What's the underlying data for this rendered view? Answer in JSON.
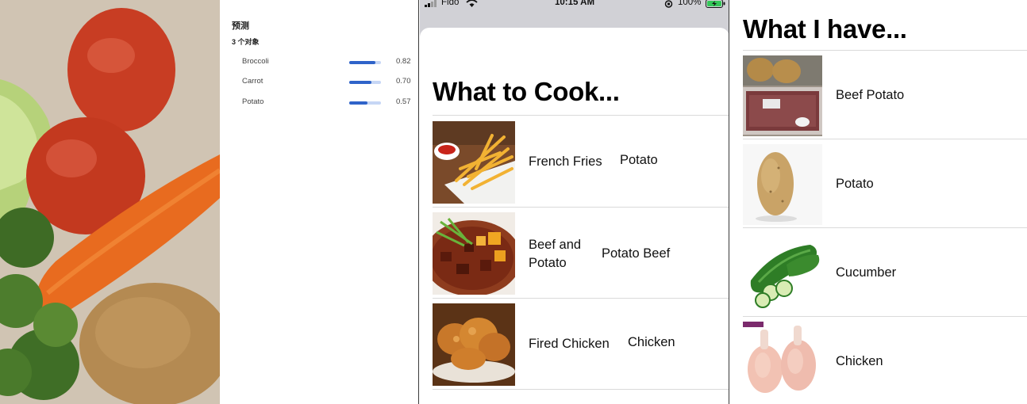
{
  "predictions": {
    "title": "预测",
    "count": "3 个对象",
    "items": [
      {
        "label": "Broccoli",
        "score": 0.82,
        "score_text": "0.82"
      },
      {
        "label": "Carrot",
        "score": 0.7,
        "score_text": "0.70"
      },
      {
        "label": "Potato",
        "score": 0.57,
        "score_text": "0.57"
      }
    ]
  },
  "status_bar": {
    "carrier": "Fido",
    "time": "10:15 AM",
    "battery": "100%"
  },
  "cook": {
    "title": "What to Cook...",
    "recipes": [
      {
        "name": "French Fries",
        "tags": "Potato",
        "image_icon": "french-fries-image"
      },
      {
        "name": "Beef and\nPotato",
        "tags": "Potato  Beef",
        "image_icon": "beef-stew-image"
      },
      {
        "name": "Fired Chicken",
        "tags": "Chicken",
        "image_icon": "fried-chicken-image"
      }
    ]
  },
  "have": {
    "title": "What I have...",
    "items": [
      {
        "label": "Beef  Potato",
        "image_icon": "beef-and-potato-image"
      },
      {
        "label": "Potato",
        "image_icon": "potato-image"
      },
      {
        "label": "Cucumber",
        "image_icon": "cucumber-image"
      },
      {
        "label": "Chicken",
        "image_icon": "chicken-drumsticks-image"
      }
    ]
  },
  "colors": {
    "score_bar": "#2f63c9",
    "score_track": "#c6d6f5",
    "battery": "#34c759"
  }
}
